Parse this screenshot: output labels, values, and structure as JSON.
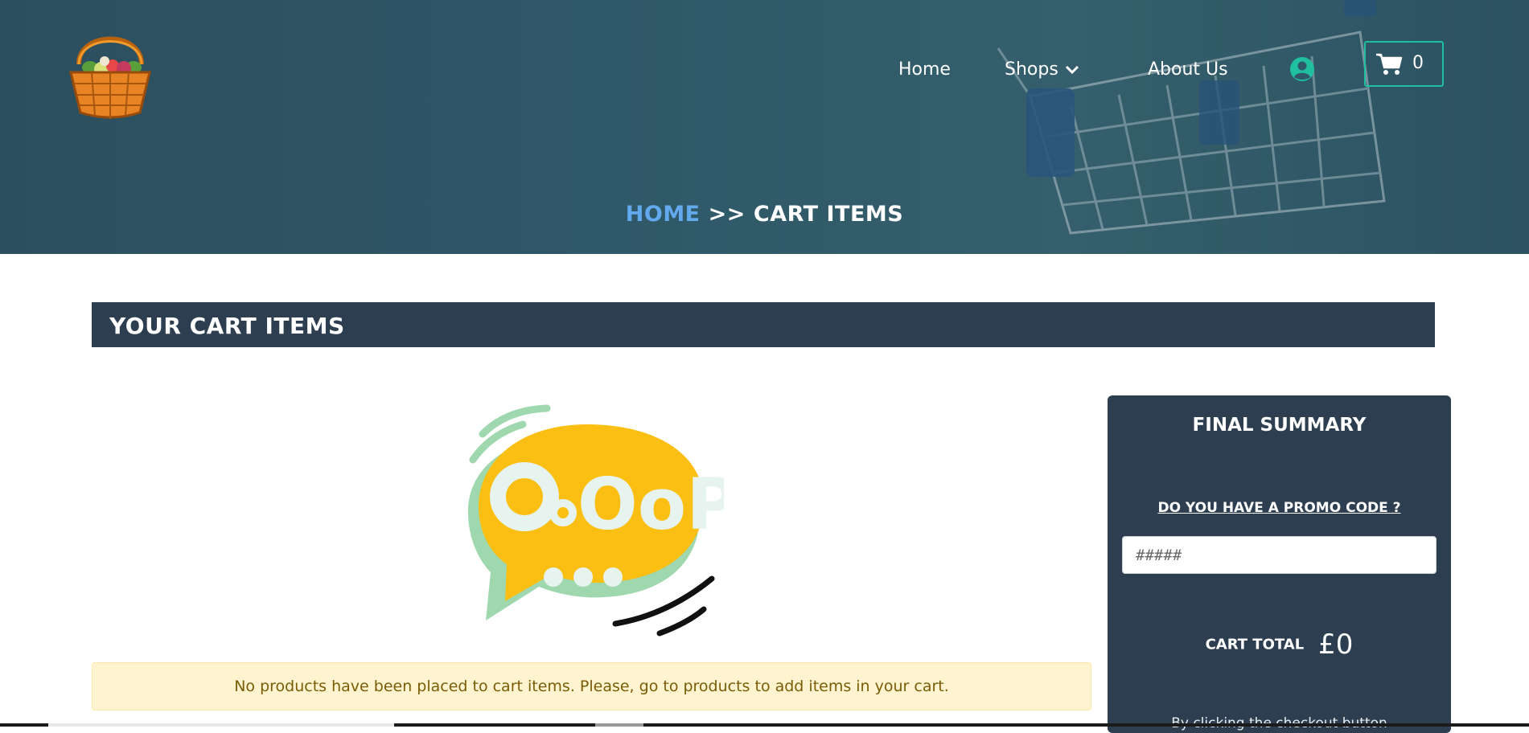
{
  "nav": {
    "home": "Home",
    "shops": "Shops",
    "about": "About Us",
    "cart_count": "0"
  },
  "breadcrumb": {
    "home": "HOME",
    "separator": ">>",
    "current": "CART ITEMS"
  },
  "section": {
    "title": "YOUR CART ITEMS"
  },
  "illustration": {
    "text": "OoPS"
  },
  "alert": {
    "message": "No products have been placed to cart items. Please, go to products to add items in your cart."
  },
  "summary": {
    "title": "FINAL SUMMARY",
    "promo_prompt": "DO YOU HAVE A PROMO CODE ?",
    "promo_placeholder": "#####",
    "total_label": "CART TOTAL",
    "total_value": "£0",
    "checkout_note": "By clicking the checkout button"
  },
  "colors": {
    "hero_bg": "#2f5868",
    "panel_bg": "#2d3e51",
    "accent_teal": "#1fbf9f",
    "breadcrumb_link": "#63a9ee",
    "alert_bg": "#fff4cf",
    "alert_text": "#7a5c06",
    "oops_yellow": "#fbbf14",
    "oops_green": "#9fd8ae"
  }
}
